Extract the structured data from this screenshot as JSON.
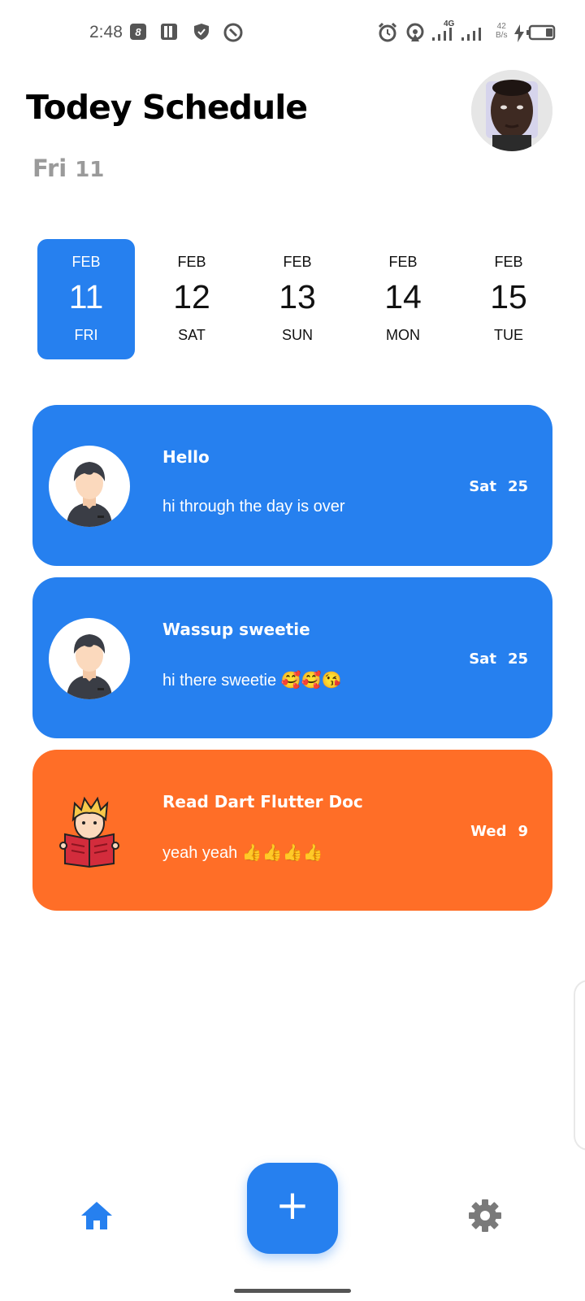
{
  "status_bar": {
    "time": "2:48",
    "network_type": "4G",
    "net_speed_value": "42",
    "net_speed_unit": "B/s",
    "icons": [
      "notification-8-icon",
      "parking-icon",
      "shield-icon",
      "vpn-icon",
      "alarm-icon",
      "hotspot-icon",
      "signal-icon",
      "signal-icon",
      "charging-icon",
      "battery-icon"
    ]
  },
  "header": {
    "title": "Todey Schedule",
    "day_name": "Fri",
    "day_number": "11",
    "avatar": "profile-photo"
  },
  "date_strip": [
    {
      "month": "FEB",
      "day": "11",
      "weekday": "FRI",
      "selected": true
    },
    {
      "month": "FEB",
      "day": "12",
      "weekday": "SAT",
      "selected": false
    },
    {
      "month": "FEB",
      "day": "13",
      "weekday": "SUN",
      "selected": false
    },
    {
      "month": "FEB",
      "day": "14",
      "weekday": "MON",
      "selected": false
    },
    {
      "month": "FEB",
      "day": "15",
      "weekday": "TUE",
      "selected": false
    }
  ],
  "cards": [
    {
      "title": "Hello",
      "text": "hi through the day is over",
      "day_name": "Sat",
      "day_number": "25",
      "color": "#2680ef",
      "icon": "male-avatar-icon"
    },
    {
      "title": "Wassup sweetie",
      "text": "hi there sweetie 🥰🥰😘",
      "day_name": "Sat",
      "day_number": "25",
      "color": "#2680ef",
      "icon": "male-avatar-icon"
    },
    {
      "title": "Read Dart Flutter Doc",
      "text": "yeah yeah 👍👍👍👍",
      "day_name": "Wed",
      "day_number": "9",
      "color": "#ff6e27",
      "icon": "reading-boy-icon"
    }
  ],
  "bottom_nav": {
    "home_icon": "home-icon",
    "fab_label": "+",
    "settings_icon": "gear-icon",
    "active_color": "#2680ef",
    "inactive_color": "#7a7a7a"
  }
}
